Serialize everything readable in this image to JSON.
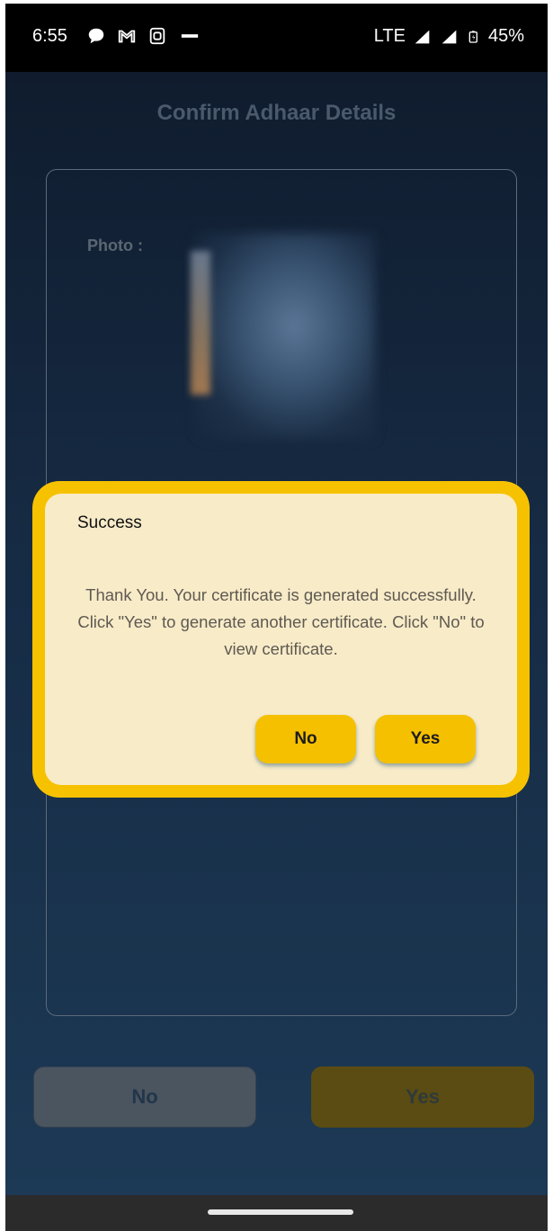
{
  "status_bar": {
    "time": "6:55",
    "network": "LTE",
    "battery": "45%",
    "icons": [
      "chat-icon",
      "gmail-icon",
      "app-icon",
      "misc-icon",
      "signal-icon",
      "signal-icon",
      "battery-icon"
    ]
  },
  "page": {
    "title": "Confirm Adhaar Details",
    "photo_label": "Photo :"
  },
  "bottom_buttons": {
    "no_label": "No",
    "yes_label": "Yes"
  },
  "dialog": {
    "title": "Success",
    "message": "Thank You. Your certificate is generated successfully. Click \"Yes\" to generate another certificate. Click \"No\" to view certificate.",
    "no_label": "No",
    "yes_label": "Yes"
  },
  "colors": {
    "accent": "#f6c200",
    "dialog_bg": "#f8ebc8",
    "screen_bg": "#162b44"
  }
}
